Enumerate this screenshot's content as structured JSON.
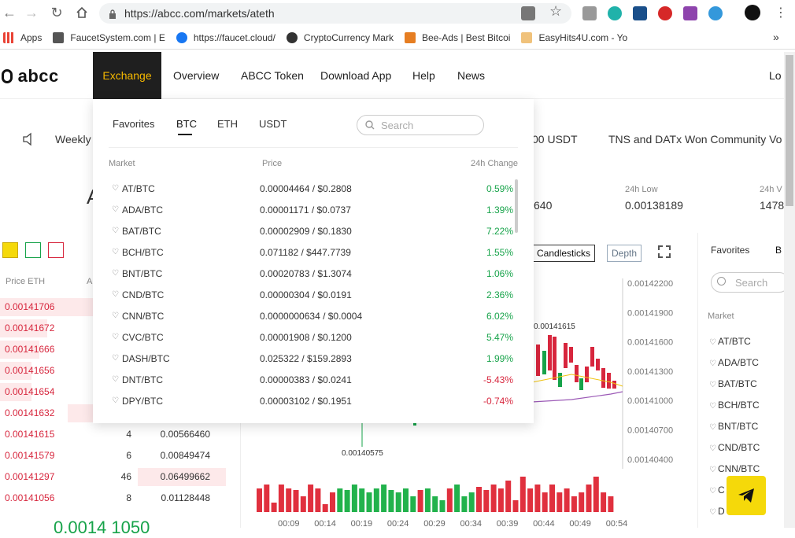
{
  "browser": {
    "url": "https://abcc.com/markets/ateth",
    "bookmarks": [
      {
        "label": "Apps"
      },
      {
        "label": "FaucetSystem.com | E"
      },
      {
        "label": "https://faucet.cloud/"
      },
      {
        "label": "CryptoCurrency Mark"
      },
      {
        "label": "Bee-Ads | Best Bitcoi"
      },
      {
        "label": "EasyHits4U.com - Yo"
      }
    ],
    "more_label": "»"
  },
  "header": {
    "logo": "abcc",
    "nav": [
      "Exchange",
      "Overview",
      "ABCC Token",
      "Download App",
      "Help",
      "News"
    ],
    "login": "Lo"
  },
  "ticker": {
    "left": "Weekly",
    "mid": "00 USDT",
    "right": "TNS and DATx Won Community Vo"
  },
  "stats": {
    "partial_value": "640",
    "low_label": "24h Low",
    "low_value": "0.00138189",
    "vol_label": "24h V",
    "vol_value": "1478",
    "big_partial": "A"
  },
  "orderbook": {
    "headers": [
      "Price ETH",
      "A"
    ],
    "rows": [
      {
        "price": "0.00141706",
        "amount": "",
        "total": ""
      },
      {
        "price": "0.00141672",
        "amount": "",
        "total": ""
      },
      {
        "price": "0.00141666",
        "amount": "",
        "total": ""
      },
      {
        "price": "0.00141656",
        "amount": "",
        "total": ""
      },
      {
        "price": "0.00141654",
        "amount": "",
        "total": ""
      },
      {
        "price": "0.00141632",
        "amount": "",
        "total": ""
      },
      {
        "price": "0.00141615",
        "amount": "4",
        "total": "0.00566460"
      },
      {
        "price": "0.00141579",
        "amount": "6",
        "total": "0.00849474"
      },
      {
        "price": "0.00141297",
        "amount": "46",
        "total": "0.06499662"
      },
      {
        "price": "0.00141056",
        "amount": "8",
        "total": "0.01128448"
      }
    ],
    "last_price": "0.0014 1050"
  },
  "chart": {
    "buttons": [
      "Candlesticks",
      "Depth"
    ],
    "y_ticks": [
      "0.00142200",
      "0.00141900",
      "0.00141600",
      "0.00141300",
      "0.00141000",
      "0.00140700",
      "0.00140400"
    ],
    "x_ticks": [
      "00:09",
      "00:14",
      "00:19",
      "00:24",
      "00:29",
      "00:34",
      "00:39",
      "00:44",
      "00:49",
      "00:54"
    ],
    "high_label": "0.00141615",
    "low_label": "0.00140575"
  },
  "right_panel": {
    "tabs": [
      "Favorites",
      "B"
    ],
    "search_placeholder": "Search",
    "market_label": "Market",
    "markets": [
      "AT/BTC",
      "ADA/BTC",
      "BAT/BTC",
      "BCH/BTC",
      "BNT/BTC",
      "CND/BTC",
      "CNN/BTC",
      "C",
      "D"
    ]
  },
  "dropdown": {
    "tabs": [
      "Favorites",
      "BTC",
      "ETH",
      "USDT"
    ],
    "search_placeholder": "Search",
    "headers": [
      "Market",
      "Price",
      "24h Change"
    ],
    "rows": [
      {
        "market": "AT/BTC",
        "price": "0.00004464 / $0.2808",
        "change": "0.59%",
        "dir": "pos"
      },
      {
        "market": "ADA/BTC",
        "price": "0.00001171 / $0.0737",
        "change": "1.39%",
        "dir": "pos"
      },
      {
        "market": "BAT/BTC",
        "price": "0.00002909 / $0.1830",
        "change": "7.22%",
        "dir": "pos"
      },
      {
        "market": "BCH/BTC",
        "price": "0.071182 / $447.7739",
        "change": "1.55%",
        "dir": "pos"
      },
      {
        "market": "BNT/BTC",
        "price": "0.00020783 / $1.3074",
        "change": "1.06%",
        "dir": "pos"
      },
      {
        "market": "CND/BTC",
        "price": "0.00000304 / $0.0191",
        "change": "2.36%",
        "dir": "pos"
      },
      {
        "market": "CNN/BTC",
        "price": "0.0000000634 / $0.0004",
        "change": "6.02%",
        "dir": "pos"
      },
      {
        "market": "CVC/BTC",
        "price": "0.00001908 / $0.1200",
        "change": "5.47%",
        "dir": "pos"
      },
      {
        "market": "DASH/BTC",
        "price": "0.025322 / $159.2893",
        "change": "1.99%",
        "dir": "pos"
      },
      {
        "market": "DNT/BTC",
        "price": "0.00000383 / $0.0241",
        "change": "-5.43%",
        "dir": "neg"
      },
      {
        "market": "DPY/BTC",
        "price": "0.00003102 / $0.1951",
        "change": "-0.74%",
        "dir": "neg"
      }
    ]
  },
  "colors": {
    "accent": "#f5b800",
    "up": "#17a34a",
    "down": "#d7263d"
  }
}
